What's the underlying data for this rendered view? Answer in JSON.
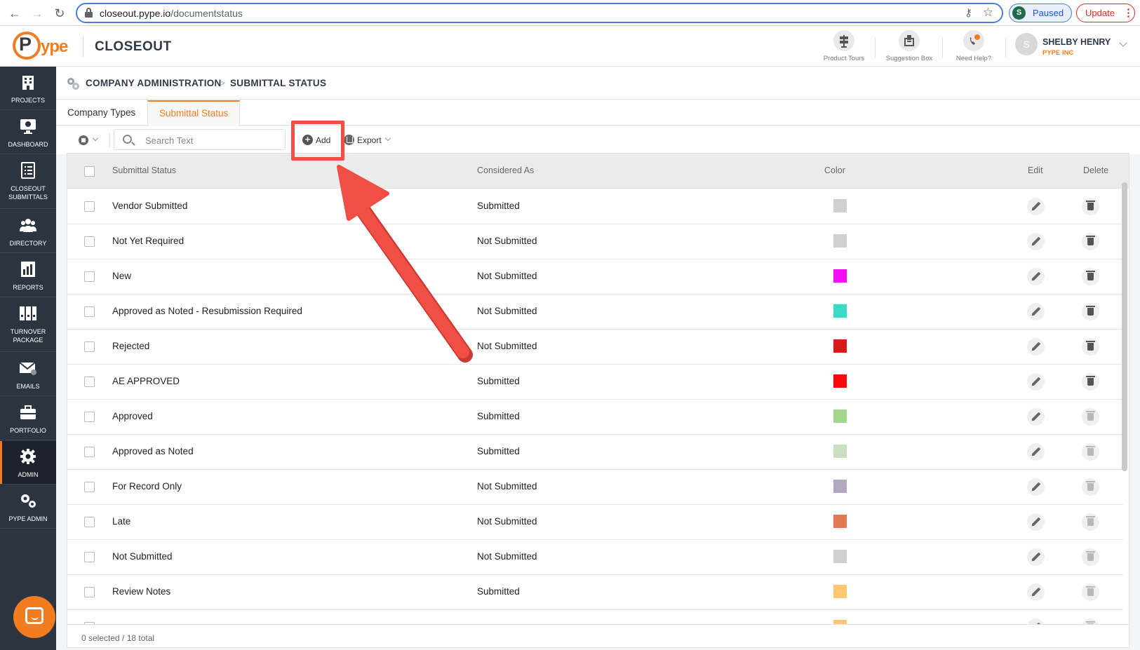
{
  "browser": {
    "url_domain": "closeout.pype.io",
    "url_path": "/documentstatus",
    "profile_initial": "S",
    "profile_status": "Paused",
    "update_label": "Update"
  },
  "header": {
    "logo_p": "P",
    "logo_rest": "ype",
    "app_title": "CLOSEOUT",
    "tools": [
      {
        "label": "Product Tours",
        "icon": "signpost-icon"
      },
      {
        "label": "Suggestion Box",
        "icon": "suggestion-box-icon"
      },
      {
        "label": "Need Help?",
        "icon": "help-phone-icon"
      }
    ],
    "user": {
      "initial": "S",
      "name": "SHELBY HENRY",
      "company": "PYPE INC"
    }
  },
  "sidebar": {
    "items": [
      {
        "label": "PROJECTS",
        "icon": "building-icon"
      },
      {
        "label": "DASHBOARD",
        "icon": "monitor-icon"
      },
      {
        "label": "CLOSEOUT\nSUBMITTALS",
        "icon": "checklist-icon"
      },
      {
        "label": "DIRECTORY",
        "icon": "people-icon"
      },
      {
        "label": "REPORTS",
        "icon": "report-icon"
      },
      {
        "label": "TURNOVER\nPACKAGE",
        "icon": "binders-icon"
      },
      {
        "label": "EMAILS",
        "icon": "envelope-icon"
      },
      {
        "label": "PORTFOLIO",
        "icon": "briefcase-icon"
      },
      {
        "label": "ADMIN",
        "icon": "gear-icon"
      },
      {
        "label": "PYPE ADMIN",
        "icon": "gears-icon"
      }
    ],
    "active": "ADMIN"
  },
  "breadcrumb": {
    "parent": "COMPANY ADMINISTRATION",
    "separator": ">",
    "current": "SUBMITTAL STATUS"
  },
  "tabs": [
    {
      "label": "Company Types",
      "active": false
    },
    {
      "label": "Submittal Status",
      "active": true
    }
  ],
  "toolbar": {
    "search_placeholder": "Search Text",
    "add_label": "Add",
    "export_label": "Export"
  },
  "table": {
    "columns": [
      "Submittal Status",
      "Considered As",
      "Color",
      "Edit",
      "Delete"
    ],
    "rows": [
      {
        "status": "Vendor Submitted",
        "considered": "Submitted",
        "color": "#cfcfcf",
        "delete_enabled": true
      },
      {
        "status": "Not Yet Required",
        "considered": "Not Submitted",
        "color": "#cfcfcf",
        "delete_enabled": true
      },
      {
        "status": "New",
        "considered": "Not Submitted",
        "color": "#f40ff4",
        "delete_enabled": true
      },
      {
        "status": "Approved as Noted - Resubmission Required",
        "considered": "Not Submitted",
        "color": "#3dd9c4",
        "delete_enabled": true
      },
      {
        "status": "Rejected",
        "considered": "Not Submitted",
        "color": "#d81a1a",
        "delete_enabled": true
      },
      {
        "status": "AE APPROVED",
        "considered": "Submitted",
        "color": "#f50a0a",
        "delete_enabled": true
      },
      {
        "status": "Approved",
        "considered": "Submitted",
        "color": "#a3d68f",
        "delete_enabled": false
      },
      {
        "status": "Approved as Noted",
        "considered": "Submitted",
        "color": "#c8dfc0",
        "delete_enabled": false
      },
      {
        "status": "For Record Only",
        "considered": "Not Submitted",
        "color": "#b3a8c0",
        "delete_enabled": false
      },
      {
        "status": "Late",
        "considered": "Not Submitted",
        "color": "#e07a52",
        "delete_enabled": false
      },
      {
        "status": "Not Submitted",
        "considered": "Not Submitted",
        "color": "#cfcfcf",
        "delete_enabled": false
      },
      {
        "status": "Review Notes",
        "considered": "Submitted",
        "color": "#ffc870",
        "delete_enabled": false
      },
      {
        "status": "",
        "considered": "",
        "color": "#ffc870",
        "delete_enabled": false
      }
    ],
    "footer": "0 selected / 18 total"
  },
  "colors": {
    "accent": "#f27d20",
    "sidebar": "#2c3440",
    "annotation": "#f04f45"
  }
}
